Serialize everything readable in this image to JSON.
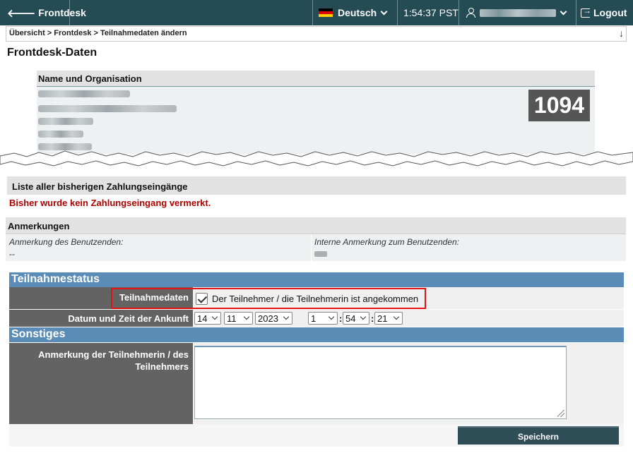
{
  "topbar": {
    "back_label": "Frontdesk",
    "language": "Deutsch",
    "time": "1:54:37 PST",
    "logout_label": "Logout"
  },
  "breadcrumb": {
    "path": "Übersicht > Frontdesk > Teilnahmedaten ändern"
  },
  "page": {
    "title": "Frontdesk-Daten"
  },
  "org": {
    "header": "Name und Organisation",
    "number": "1094"
  },
  "payments": {
    "header": "Liste aller bisherigen Zahlungseingänge",
    "message": "Bisher wurde kein Zahlungseingang vermerkt."
  },
  "remarks": {
    "header": "Anmerkungen",
    "user_label": "Anmerkung des Benutzenden:",
    "user_value": "--",
    "internal_label": "Interne Anmerkung zum Benutzenden:"
  },
  "status": {
    "section_title": "Teilnahmestatus",
    "attendance_label": "Teilnahmedaten",
    "checkbox_label": "Der Teilnehmer / die Teilnehmerin ist angekommen",
    "arrival_label": "Datum und Zeit der Ankunft",
    "day": "14",
    "month": "11",
    "year": "2023",
    "hour": "1",
    "minute": "54",
    "second": "21"
  },
  "other": {
    "section_title": "Sonstiges",
    "note_label": "Anmerkung der Teilnehmerin / des Teilnehmers"
  },
  "actions": {
    "save_label": "Speichern"
  },
  "colors": {
    "topbar": "#254b55",
    "section_header": "#5a8cb5",
    "label_bg": "#636363",
    "error_text": "#b00000",
    "highlight": "#e01414"
  }
}
